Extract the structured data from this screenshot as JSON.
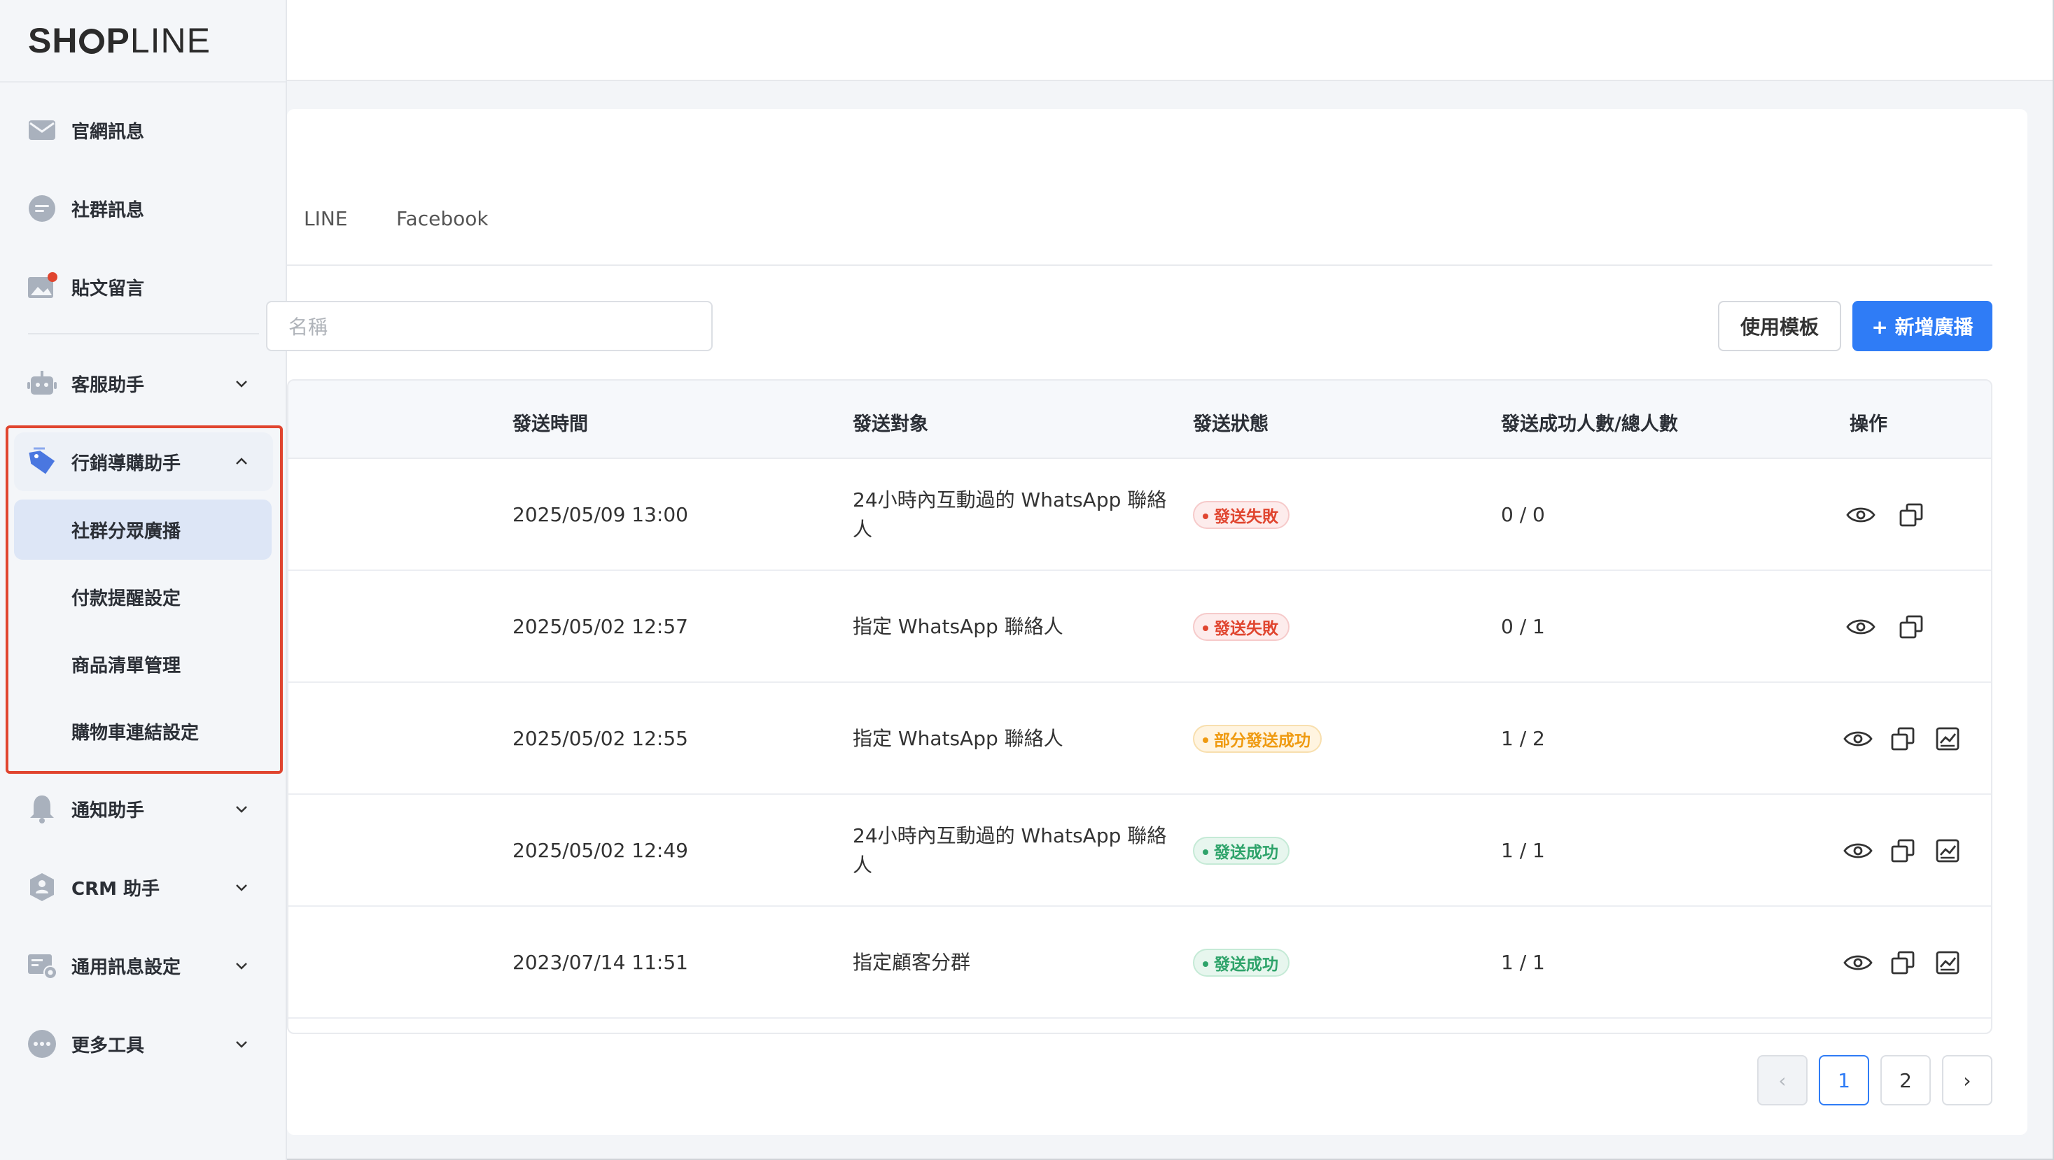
{
  "brand": {
    "logo_prefix": "SH",
    "logo_o": "O",
    "logo_p": "P",
    "logo_suffix": "LINE"
  },
  "sidebar": {
    "items": [
      {
        "label": "官網訊息",
        "icon": "mail-icon"
      },
      {
        "label": "社群訊息",
        "icon": "chat-bubble-icon"
      },
      {
        "label": "貼文留言",
        "icon": "image-post-icon"
      },
      {
        "label": "客服助手",
        "icon": "robot-icon"
      },
      {
        "label": "行銷導購助手",
        "icon": "price-tag-icon"
      },
      {
        "label": "通知助手",
        "icon": "bell-icon"
      },
      {
        "label": "CRM 助手",
        "icon": "user-shield-icon"
      },
      {
        "label": "通用訊息設定",
        "icon": "message-settings-icon"
      },
      {
        "label": "更多工具",
        "icon": "more-dots-icon"
      }
    ],
    "sub_items": [
      {
        "label": "社群分眾廣播",
        "active": true
      },
      {
        "label": "付款提醒設定",
        "active": false
      },
      {
        "label": "商品清單管理",
        "active": false
      },
      {
        "label": "購物車連結設定",
        "active": false
      }
    ],
    "accent_color": "#4a77e0",
    "highlight_color": "#e0452f"
  },
  "tabs": [
    {
      "label": "LINE"
    },
    {
      "label": "Facebook"
    }
  ],
  "search": {
    "placeholder": "名稱"
  },
  "toolbar": {
    "template_label": "使用模板",
    "new_label": "+ 新增廣播",
    "primary_color": "#2f7cf6"
  },
  "table": {
    "headers": [
      "發送時間",
      "發送對象",
      "發送狀態",
      "發送成功人數/總人數",
      "操作"
    ],
    "rows": [
      {
        "time": "2025/05/09 13:00",
        "target_line1": "24小時內互動過的 WhatsApp 聯絡",
        "target_line2": "人",
        "status": "發送失敗",
        "count": "0 / 0"
      },
      {
        "time": "2025/05/02 12:57",
        "target_line1": "指定 WhatsApp 聯絡人",
        "target_line2": "",
        "status": "發送失敗",
        "count": "0 / 1"
      },
      {
        "time": "2025/05/02 12:55",
        "target_line1": "指定 WhatsApp 聯絡人",
        "target_line2": "",
        "status": "部分發送成功",
        "count": "1 / 2"
      },
      {
        "time": "2025/05/02 12:49",
        "target_line1": "24小時內互動過的 WhatsApp 聯絡",
        "target_line2": "人",
        "status": "發送成功",
        "count": "1 / 1"
      },
      {
        "time": "2023/07/14 11:51",
        "target_line1": "指定顧客分群",
        "target_line2": "",
        "status": "發送成功",
        "count": "1 / 1"
      }
    ],
    "status_colors": {
      "fail": "#e0452f",
      "partial": "#ef9a10",
      "success": "#2ea36a"
    }
  },
  "pagination": {
    "prev": "‹",
    "pages": [
      "1",
      "2"
    ],
    "current": "1",
    "next": "›"
  }
}
